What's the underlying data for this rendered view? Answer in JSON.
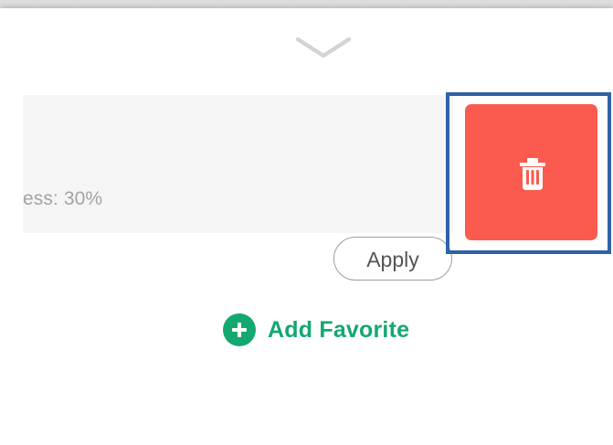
{
  "icons": {
    "collapse": "chevron-down-icon",
    "delete": "trash-icon",
    "add": "plus-circle-icon"
  },
  "favorite_item": {
    "visible_text": "ess: 30%",
    "apply_label": "Apply",
    "delete_color": "#fb5a4f",
    "selection_outline_color": "#2f62a8"
  },
  "add_favorite": {
    "label": "Add Favorite",
    "accent_color": "#14a870"
  }
}
